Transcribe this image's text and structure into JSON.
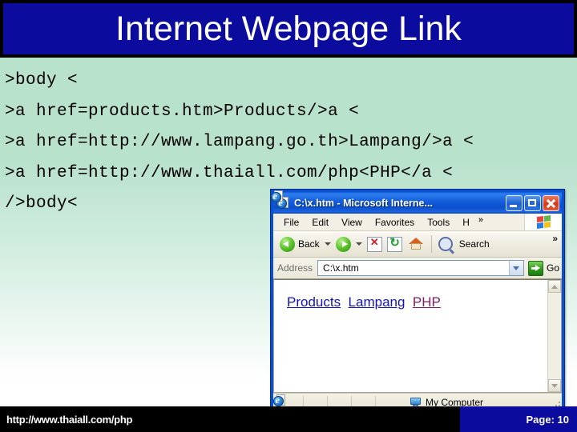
{
  "slide": {
    "title": "Internet Webpage Link",
    "code_lines": [
      ">body <",
      ">a href=products.htm>Products/>a <",
      ">a href=http://www.lampang.go.th>Lampang/>a <",
      ">a href=http://www.thaiall.com/php<PHP</a <",
      "/>body<"
    ]
  },
  "browser": {
    "title": "C:\\x.htm - Microsoft Interne...",
    "window_buttons": {
      "minimize": "Minimize",
      "maximize": "Maximize",
      "close": "Close"
    },
    "menu": [
      {
        "label": "File",
        "accel": "F",
        "rest": "ile"
      },
      {
        "label": "Edit",
        "accel": "E",
        "rest": "dit"
      },
      {
        "label": "View",
        "accel": "V",
        "rest": "iew"
      },
      {
        "label": "Favorites",
        "pre": "F",
        "accel": "a",
        "rest": "vorites"
      },
      {
        "label": "Tools",
        "accel": "T",
        "rest": "ools"
      },
      {
        "label": "H",
        "accel": "H",
        "rest": ""
      }
    ],
    "menu_overflow": "»",
    "toolbar": {
      "back_label": "Back",
      "forward_label": "",
      "stop_label": "Stop",
      "refresh_label": "Refresh",
      "home_label": "Home",
      "search_label": "Search",
      "overflow": "»"
    },
    "address": {
      "label": "Address",
      "value": "C:\\x.htm",
      "go_label": "Go"
    },
    "page": {
      "links": [
        {
          "text": "Products",
          "state": "unvisited"
        },
        {
          "text": "Lampang",
          "state": "unvisited"
        },
        {
          "text": "PHP",
          "state": "visited"
        }
      ]
    },
    "status": {
      "zone_text": "My Computer"
    }
  },
  "footer": {
    "url": "http://www.thaiall.com/php",
    "page_label": "Page: 10"
  },
  "colors": {
    "title_blue": "#0b0b9e",
    "slide_bg_top": "#b9e2cd",
    "slide_bg_bottom": "#ffffff",
    "link_unvisited": "#1414b4",
    "link_visited": "#7a2060",
    "footer_bar": "#000000"
  }
}
